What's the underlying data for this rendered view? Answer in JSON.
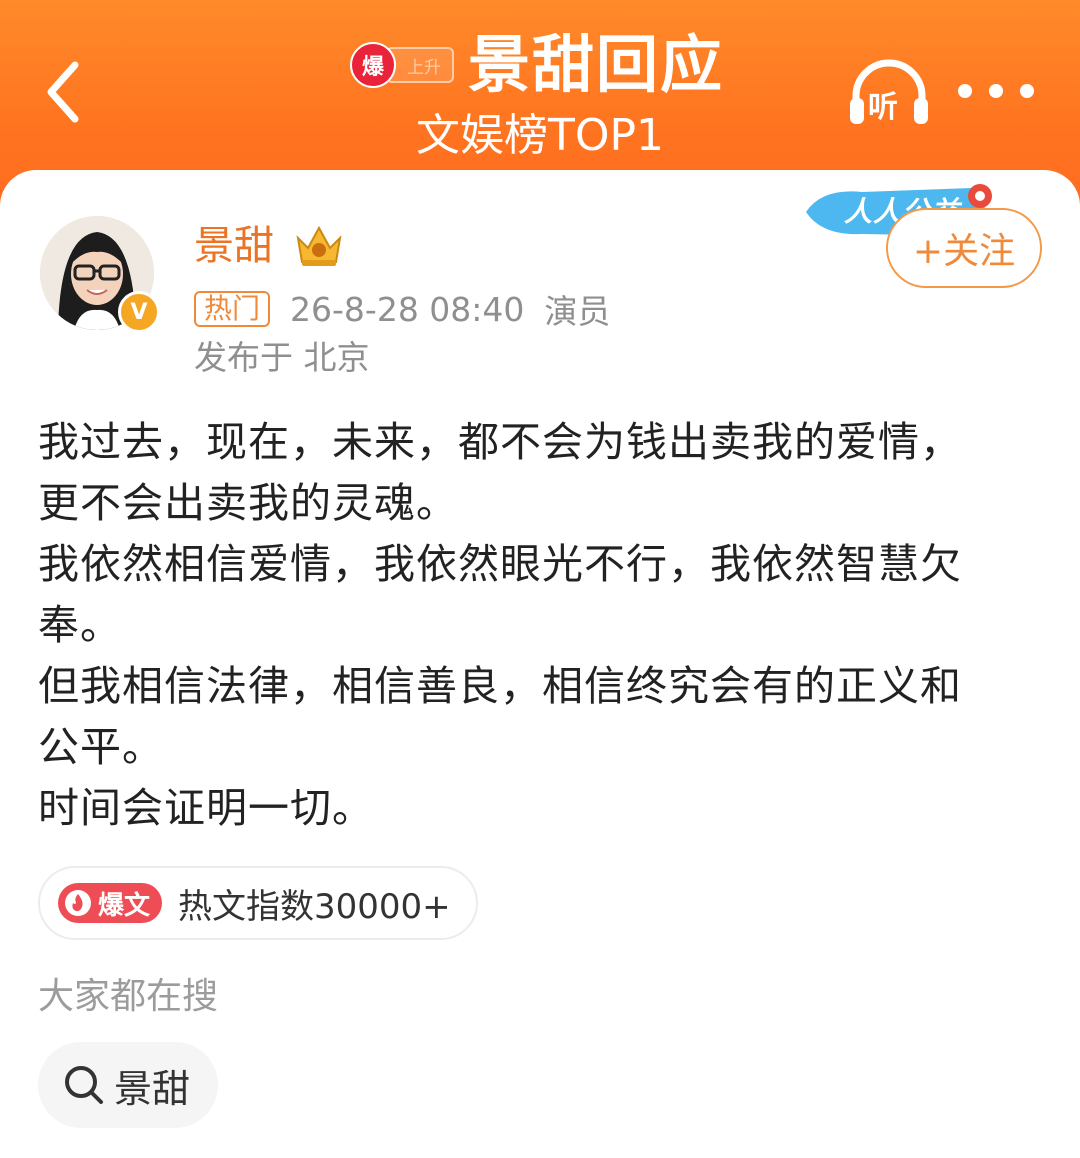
{
  "header": {
    "back_icon": "chevron-left-icon",
    "badge_label": "爆",
    "badge_ghost_label": "上升",
    "title": "景甜回应",
    "subtitle": "文娱榜TOP1",
    "listen_label": "听",
    "more_icon": "more-dots-icon",
    "background_color": "#ff7a24"
  },
  "post": {
    "author": {
      "name": "景甜",
      "verified_icon": "verified-v-icon",
      "crown_icon": "crown-icon"
    },
    "hot_tag": "热门",
    "timestamp": "26-8-28 08:40",
    "role": "演员",
    "location": "发布于 北京",
    "ribbon_text": "人人公益",
    "follow_label": "+关注",
    "content": "我过去，现在，未来，都不会为钱出卖我的爱情，\n更不会出卖我的灵魂。\n我依然相信爱情，我依然眼光不行，我依然智慧欠\n奉。\n但我相信法律，相信善良，相信终究会有的正义和\n公平。\n时间会证明一切。",
    "hot_index": {
      "badge": "爆文",
      "text": "热文指数30000+"
    }
  },
  "search": {
    "label": "大家都在搜",
    "chips": [
      {
        "icon": "search-icon",
        "text": "景甜"
      }
    ]
  },
  "colors": {
    "accent_orange": "#eb7323",
    "hot_red": "#ef4d56"
  }
}
